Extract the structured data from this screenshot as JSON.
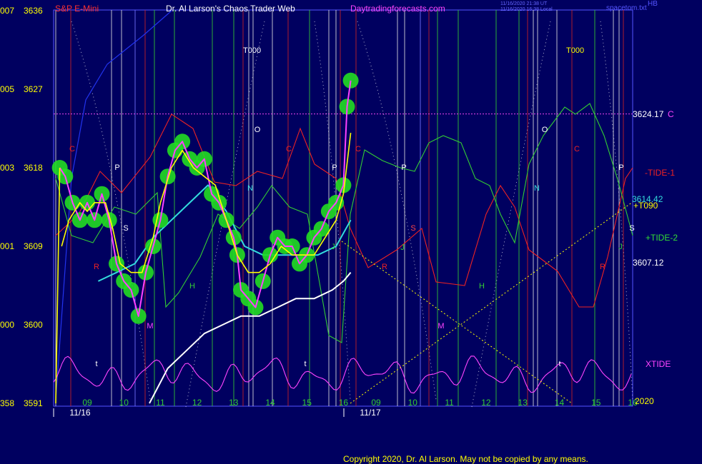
{
  "header": {
    "instrument": "S&P E-Mini",
    "site_title": "Dr. Al Larson's Chaos Trader Web",
    "website": "Daytradingforecasts.com",
    "stamp_line_1": "11/16/2020 21:38 UT",
    "stamp_line_2": "11/16/2020 16:38 Local",
    "source": "spacetom.txt",
    "corner_label": "HB"
  },
  "copyright": "Copyright 2020, Dr. Al Larson. May not be copied by any means.",
  "colors": {
    "background": "#000060",
    "price_halo": "#22dd22",
    "price": "#ff40ff",
    "fast_avg": "#ffff00",
    "mid_avg": "#33dddd",
    "slow_avg": "#ffffff",
    "tide_1": "#ee2222",
    "tide_2": "#33cc33",
    "xtide": "#ff44ff",
    "level_line": "#ee44ee",
    "cross_lines": "#ffff00"
  },
  "chart_data": {
    "type": "line",
    "title": "S&P E-Mini",
    "y_ticks": [
      {
        "left": "007",
        "right": "3636",
        "value": 3636
      },
      {
        "left": "005",
        "right": "3627",
        "value": 3627
      },
      {
        "left": "003",
        "right": "3618",
        "value": 3618
      },
      {
        "left": "001",
        "right": "3609",
        "value": 3609
      },
      {
        "left": "000",
        "right": "3600",
        "value": 3600
      },
      {
        "left": "358",
        "right": "3591",
        "value": 3591
      }
    ],
    "ylim": [
      3591,
      3636
    ],
    "x_hour_ticks": [
      "09",
      "10",
      "11",
      "12",
      "13",
      "14",
      "15",
      "16",
      "09",
      "10",
      "11",
      "12",
      "13",
      "14",
      "15",
      "16"
    ],
    "x_dates": [
      "11/16",
      "11/17"
    ],
    "price_levels": [
      {
        "label": "3624.17",
        "value": 3624.17,
        "tag": "C"
      },
      {
        "label": "3614.42",
        "value": 3614.42
      },
      {
        "label": "3607.12",
        "value": 3607.12
      }
    ],
    "series_labels": [
      "-TIDE-1",
      "+TIDE-2",
      "XTIDE",
      "+T090"
    ],
    "bottom_right_label": "2020",
    "event_markers": [
      "T000",
      "T000"
    ],
    "planet_markers": [
      "C",
      "P",
      "S",
      "R",
      "M",
      "H",
      "O",
      "N",
      "J",
      "t"
    ],
    "price_series": {
      "name": "S&P E-Mini",
      "x_hours": [
        8.25,
        8.4,
        8.6,
        8.8,
        9.0,
        9.2,
        9.4,
        9.6,
        9.8,
        10.0,
        10.2,
        10.4,
        10.6,
        10.8,
        11.0,
        11.2,
        11.4,
        11.6,
        11.8,
        12.0,
        12.2,
        12.4,
        12.6,
        12.8,
        13.0,
        13.1,
        13.2,
        13.4,
        13.6,
        13.8,
        14.0,
        14.2,
        14.4,
        14.6,
        14.8,
        15.0,
        15.2,
        15.4,
        15.6,
        15.8,
        16.0,
        16.1,
        16.2
      ],
      "values": [
        3618,
        3617,
        3614,
        3612,
        3614,
        3612,
        3615,
        3612,
        3607,
        3605,
        3604,
        3601,
        3606,
        3609,
        3612,
        3617,
        3620,
        3621,
        3619,
        3618,
        3619,
        3615,
        3614,
        3612,
        3610,
        3608,
        3604,
        3603,
        3602,
        3605,
        3608,
        3610,
        3609,
        3609,
        3607,
        3608,
        3610,
        3611,
        3613,
        3614,
        3616,
        3625,
        3628
      ]
    },
    "fast_average": {
      "x_hours": [
        8.3,
        8.5,
        8.8,
        9.0,
        9.2,
        9.5,
        9.7,
        9.9,
        10.2,
        10.5,
        10.8,
        11.0,
        11.3,
        11.6,
        11.9,
        12.2,
        12.5,
        12.8,
        13.1,
        13.4,
        13.7,
        14.0,
        14.3,
        14.6,
        14.9,
        15.2,
        15.5,
        15.8,
        16.0,
        16.2
      ],
      "values": [
        3609,
        3612,
        3614,
        3613,
        3614,
        3614,
        3611,
        3607,
        3606,
        3606,
        3610,
        3614,
        3618,
        3620,
        3618,
        3617,
        3616,
        3612,
        3608,
        3606,
        3606,
        3607,
        3609,
        3608,
        3608,
        3608,
        3610,
        3612,
        3615,
        3622
      ]
    },
    "mid_average": {
      "x_hours": [
        9.3,
        9.8,
        10.3,
        10.8,
        11.3,
        11.8,
        12.3,
        12.8,
        13.3,
        13.8,
        14.3,
        14.8,
        15.3,
        15.8,
        16.2
      ],
      "values": [
        3605,
        3606,
        3607,
        3610,
        3612,
        3614,
        3616,
        3613,
        3609,
        3608,
        3608,
        3608,
        3608,
        3609,
        3612
      ]
    },
    "slow_average": {
      "x_hours": [
        10.7,
        11.2,
        11.7,
        12.2,
        12.7,
        13.2,
        13.7,
        14.2,
        14.7,
        15.2,
        15.7,
        16.0,
        16.2
      ],
      "values": [
        3591,
        3595,
        3597,
        3599,
        3600,
        3601,
        3601,
        3602,
        3603,
        3603,
        3604,
        3605,
        3606
      ]
    }
  }
}
